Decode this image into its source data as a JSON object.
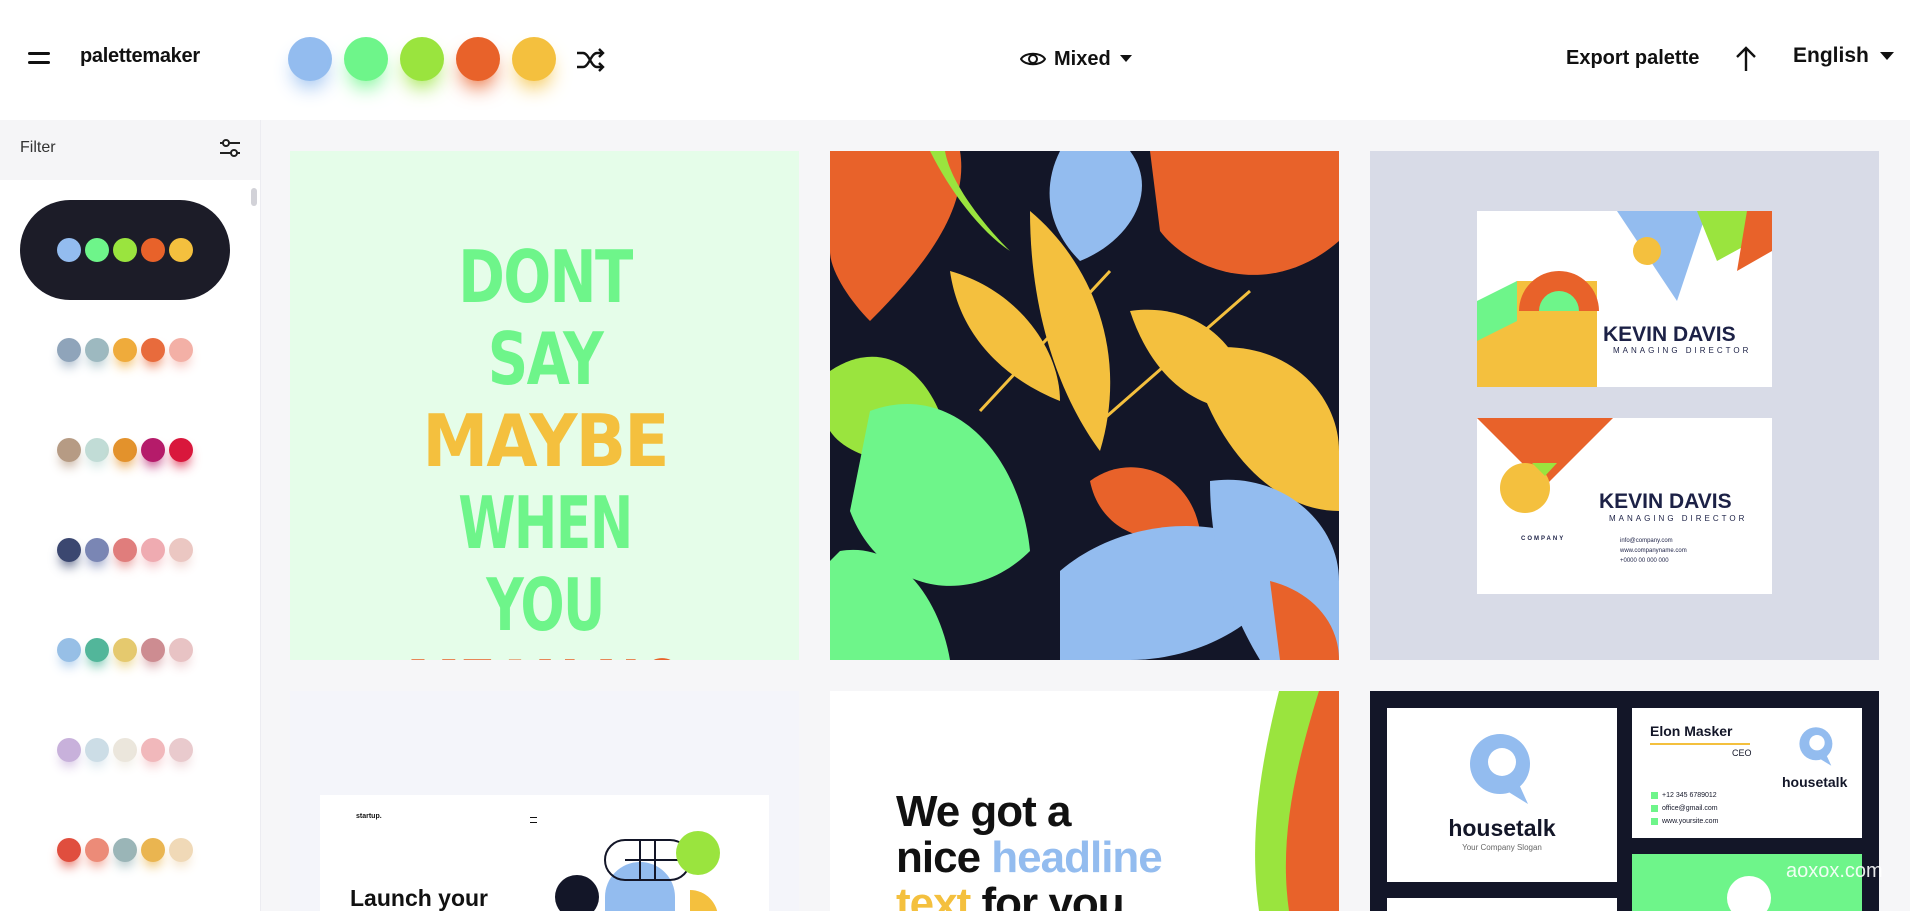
{
  "app": {
    "brand": "palettemaker"
  },
  "colors": {
    "blue": "#93bcef",
    "green": "#6ef58a",
    "lime": "#9ae43e",
    "orange": "#e8622a",
    "yellow": "#f4c03e",
    "navy": "#131628"
  },
  "topbar": {
    "palette": [
      {
        "name": "blue",
        "hex": "#93bcef"
      },
      {
        "name": "green",
        "hex": "#6ef58a"
      },
      {
        "name": "lime",
        "hex": "#9ae43e"
      },
      {
        "name": "orange",
        "hex": "#e8622a"
      },
      {
        "name": "yellow",
        "hex": "#f4c03e"
      }
    ],
    "shuffle_icon": "shuffle-icon",
    "mode_label": "Mixed",
    "export_label": "Export palette",
    "language": "English"
  },
  "sidebar": {
    "filter_label": "Filter",
    "palettes": [
      {
        "active": true,
        "colors": [
          "#93bcef",
          "#6ef58a",
          "#9ae43e",
          "#e8622a",
          "#f4c03e"
        ]
      },
      {
        "colors": [
          "#8fa4ba",
          "#9db9c0",
          "#efab3b",
          "#e86b3c",
          "#f3b0a6"
        ]
      },
      {
        "colors": [
          "#b69b84",
          "#c1dcd6",
          "#e3922c",
          "#b51b6a",
          "#d9173c"
        ]
      },
      {
        "colors": [
          "#3b4770",
          "#7a86b4",
          "#e07d7c",
          "#efabb1",
          "#ebc7c2"
        ]
      },
      {
        "colors": [
          "#97bfe6",
          "#52b69a",
          "#e5c96e",
          "#cd8c91",
          "#e8c3c4"
        ]
      },
      {
        "colors": [
          "#c8b1db",
          "#ccdde6",
          "#ebe6dc",
          "#f1b8bb",
          "#e9cacd"
        ]
      },
      {
        "colors": [
          "#e04e3e",
          "#ec8b78",
          "#9ab5b7",
          "#eab550",
          "#f0d9b7"
        ]
      }
    ]
  },
  "cards": {
    "poster_lines": [
      "DONT SAY",
      "MAYBE",
      "WHEN YOU",
      "MEAN NO"
    ],
    "bizcard_name": "KEVIN DAVIS",
    "bizcard_title": "MANAGING DIRECTOR",
    "bizcard_company": "COMPANY",
    "bizcard_contact": [
      "info@company.com",
      "www.companyname.com",
      "+0000 00 000 000"
    ],
    "startup_brand": "startup.",
    "startup_heading": "Launch your",
    "headline_part1": "We got a",
    "headline_part2": "nice",
    "headline_highlight": "headline",
    "headline_part3_hl": "text",
    "headline_part3": "for you",
    "housetalk_name": "housetalk",
    "housetalk_slogan": "Your Company Slogan",
    "housetalk_person": "Elon Masker",
    "housetalk_role": "CEO",
    "housetalk_phone": "+12 345 6789012",
    "housetalk_email": "office@gmail.com",
    "housetalk_site": "www.yoursite.com"
  },
  "watermark": "aoxox.com"
}
